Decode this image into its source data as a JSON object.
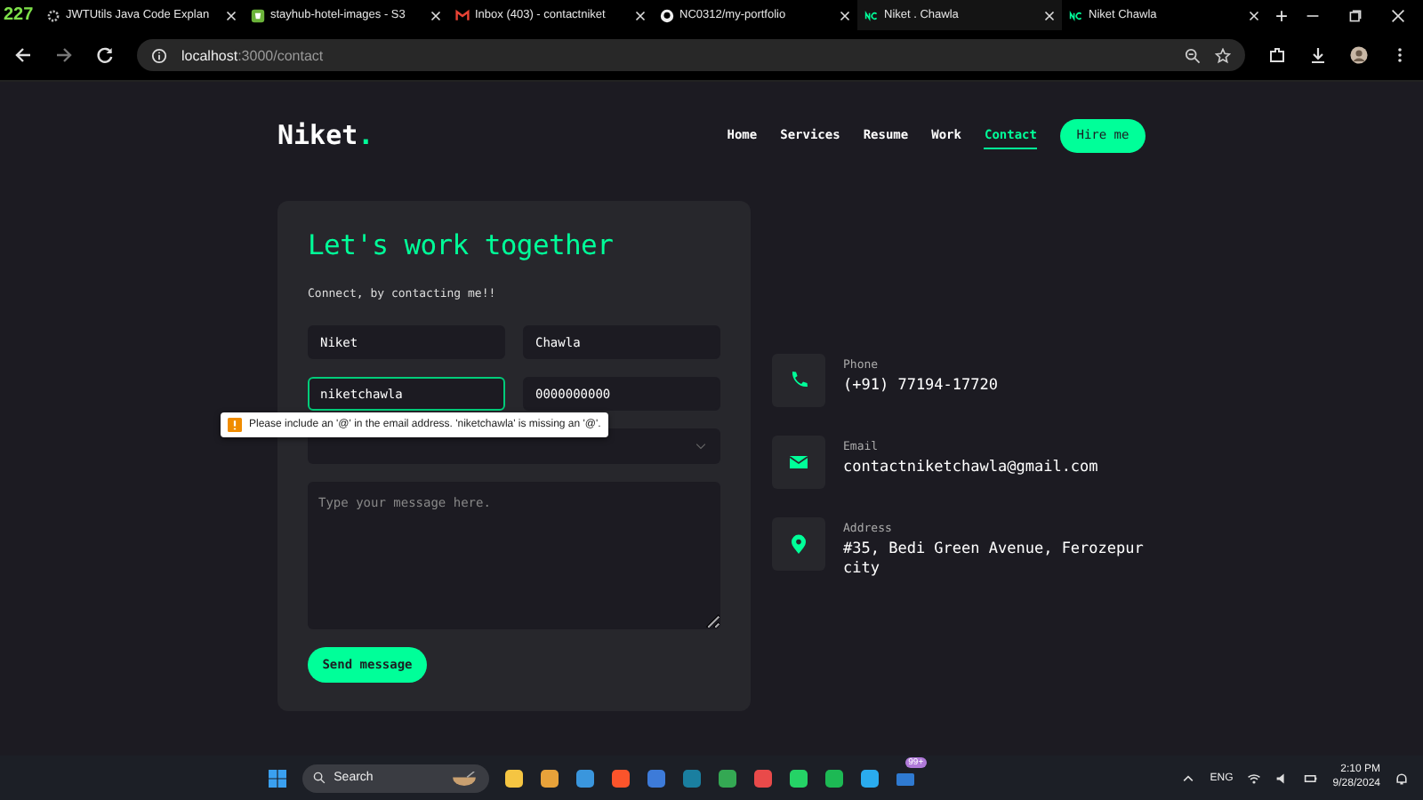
{
  "browser": {
    "counter": "227",
    "tabs": [
      {
        "title": "JWTUtils Java Code Explan",
        "selected": false
      },
      {
        "title": "stayhub-hotel-images - S3",
        "selected": false
      },
      {
        "title": "Inbox (403) - contactniket",
        "selected": false
      },
      {
        "title": "NC0312/my-portfolio",
        "selected": false
      },
      {
        "title": "Niket . Chawla",
        "selected": true
      },
      {
        "title": "Niket Chawla",
        "selected": false
      }
    ],
    "new_tab": "+",
    "url_host": "localhost",
    "url_path": ":3000/contact"
  },
  "site": {
    "logo": "Niket",
    "logo_dot": ".",
    "nav": [
      {
        "label": "Home",
        "selected": false
      },
      {
        "label": "Services",
        "selected": false
      },
      {
        "label": "Resume",
        "selected": false
      },
      {
        "label": "Work",
        "selected": false
      },
      {
        "label": "Contact",
        "selected": true
      }
    ],
    "hire_button": "Hire me"
  },
  "form": {
    "title": "Let's work together",
    "subtitle": "Connect, by contacting me!!",
    "fields": [
      {
        "value": "Niket",
        "focused": false
      },
      {
        "value": "Chawla",
        "focused": false
      },
      {
        "value": "niketchawla",
        "focused": true
      },
      {
        "value": "0000000000",
        "focused": false
      }
    ],
    "message_placeholder": "Type your message here.",
    "send_button": "Send message",
    "validation_tooltip": "Please include an '@' in the email address. 'niketchawla' is missing an '@'."
  },
  "contacts": [
    {
      "kind": "phone",
      "label": "Phone",
      "value": "(+91) 77194-17720"
    },
    {
      "kind": "email",
      "label": "Email",
      "value": "contactniketchawla@gmail.com"
    },
    {
      "kind": "address",
      "label": "Address",
      "value": "#35, Bedi Green Avenue, Ferozepur city"
    }
  ],
  "taskbar": {
    "search": "Search",
    "mail_badge": "99+",
    "language": "ENG",
    "time": "2:10 PM",
    "date": "9/28/2024"
  }
}
